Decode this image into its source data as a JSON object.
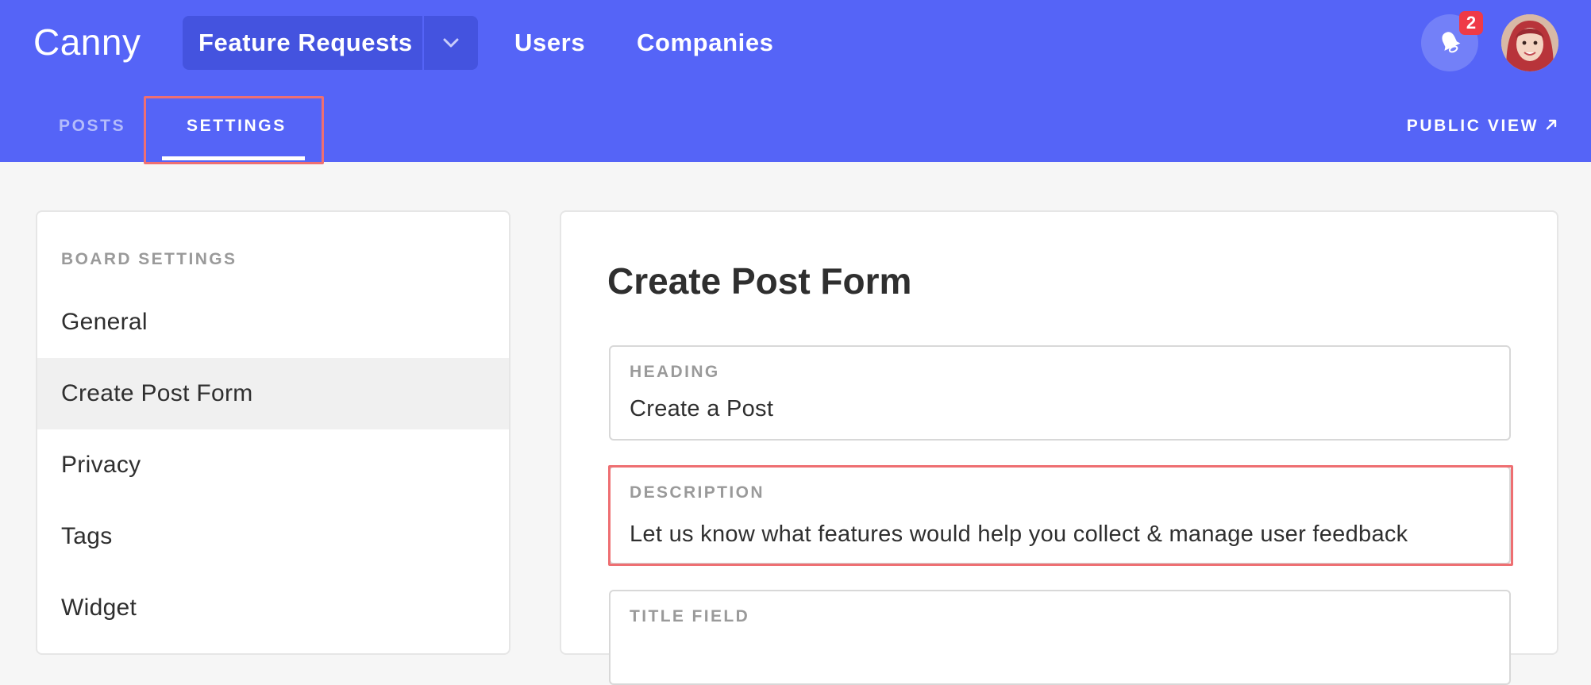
{
  "app": {
    "logo": "Canny"
  },
  "header": {
    "board_select": {
      "label": "Feature Requests",
      "chevron_icon": "chevron-down-icon"
    },
    "nav": [
      {
        "label": "Users"
      },
      {
        "label": "Companies"
      }
    ],
    "notifications": {
      "icon": "bell-icon",
      "count": "2"
    },
    "avatar": {
      "icon": "user-avatar"
    }
  },
  "subnav": {
    "tabs": [
      {
        "label": "POSTS"
      },
      {
        "label": "SETTINGS"
      }
    ],
    "active_tab": "SETTINGS",
    "public_view": {
      "label": "PUBLIC VIEW",
      "icon": "external-arrow-icon"
    }
  },
  "sidebar": {
    "heading": "BOARD SETTINGS",
    "items": [
      {
        "label": "General"
      },
      {
        "label": "Create Post Form"
      },
      {
        "label": "Privacy"
      },
      {
        "label": "Tags"
      },
      {
        "label": "Widget"
      }
    ],
    "selected": "Create Post Form"
  },
  "main": {
    "title": "Create Post Form",
    "fields": [
      {
        "label": "HEADING",
        "value": "Create a Post"
      },
      {
        "label": "DESCRIPTION",
        "value": "Let us know what features would help you collect & manage user feedback"
      },
      {
        "label": "TITLE FIELD",
        "value": ""
      }
    ]
  },
  "colors": {
    "header_bg": "#5564f7",
    "board_select_bg": "#4453df",
    "badge": "#ef3a47",
    "highlight": "#ee6f72"
  }
}
